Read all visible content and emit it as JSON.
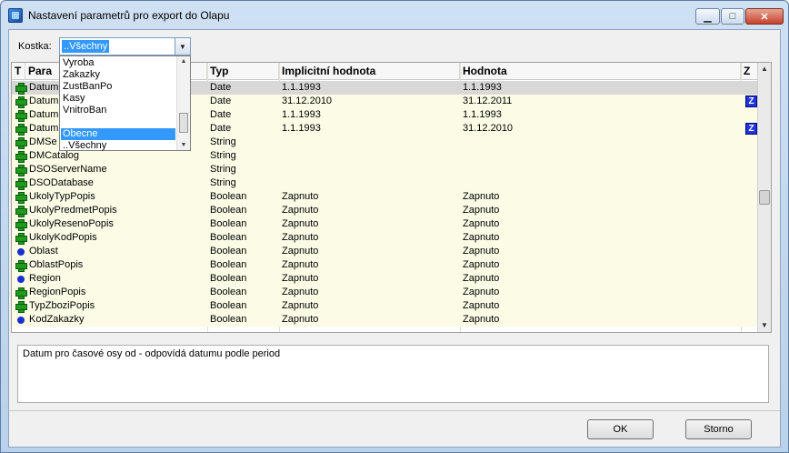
{
  "window": {
    "title": "Nastavení parametrů pro export do Olapu",
    "controls": {
      "minimize": "▁",
      "maximize": "□",
      "close": "✕"
    }
  },
  "kostka": {
    "label": "Kostka:",
    "value": "..Všechny",
    "options": [
      "Vyroba",
      "Zakazky",
      "ZustBanPo",
      "Kasy",
      "VnitroBan",
      "",
      "Obecne",
      "..Všechny"
    ],
    "active_option": "Obecne"
  },
  "grid": {
    "headers": {
      "t": "T",
      "param": "Para",
      "typ": "Typ",
      "implicit": "Implicitní hodnota",
      "hodnota": "Hodnota",
      "z": "Z"
    },
    "rows": [
      {
        "icon": "plus",
        "name": "Datum",
        "typ": "Date",
        "implicit": "1.1.1993",
        "hodnota": "1.1.1993",
        "z": ""
      },
      {
        "icon": "plus",
        "name": "Datum",
        "typ": "Date",
        "implicit": "31.12.2010",
        "hodnota": "31.12.2011",
        "z": "Z"
      },
      {
        "icon": "plus",
        "name": "Datum",
        "typ": "Date",
        "implicit": "1.1.1993",
        "hodnota": "1.1.1993",
        "z": ""
      },
      {
        "icon": "plus",
        "name": "Datum",
        "typ": "Date",
        "implicit": "1.1.1993",
        "hodnota": "31.12.2010",
        "z": "Z"
      },
      {
        "icon": "plus",
        "name": "DMSe",
        "typ": "String",
        "implicit": "",
        "hodnota": "",
        "z": ""
      },
      {
        "icon": "plus",
        "name": "DMCatalog",
        "typ": "String",
        "implicit": "",
        "hodnota": "",
        "z": ""
      },
      {
        "icon": "plus",
        "name": "DSOServerName",
        "typ": "String",
        "implicit": "",
        "hodnota": "",
        "z": ""
      },
      {
        "icon": "plus",
        "name": "DSODatabase",
        "typ": "String",
        "implicit": "",
        "hodnota": "",
        "z": ""
      },
      {
        "icon": "plus",
        "name": "UkolyTypPopis",
        "typ": "Boolean",
        "implicit": "Zapnuto",
        "hodnota": "Zapnuto",
        "z": ""
      },
      {
        "icon": "plus",
        "name": "UkolyPredmetPopis",
        "typ": "Boolean",
        "implicit": "Zapnuto",
        "hodnota": "Zapnuto",
        "z": ""
      },
      {
        "icon": "plus",
        "name": "UkolyResenoPopis",
        "typ": "Boolean",
        "implicit": "Zapnuto",
        "hodnota": "Zapnuto",
        "z": ""
      },
      {
        "icon": "plus",
        "name": "UkolyKodPopis",
        "typ": "Boolean",
        "implicit": "Zapnuto",
        "hodnota": "Zapnuto",
        "z": ""
      },
      {
        "icon": "dot",
        "name": "Oblast",
        "typ": "Boolean",
        "implicit": "Zapnuto",
        "hodnota": "Zapnuto",
        "z": ""
      },
      {
        "icon": "plus",
        "name": "OblastPopis",
        "typ": "Boolean",
        "implicit": "Zapnuto",
        "hodnota": "Zapnuto",
        "z": ""
      },
      {
        "icon": "dot",
        "name": "Region",
        "typ": "Boolean",
        "implicit": "Zapnuto",
        "hodnota": "Zapnuto",
        "z": ""
      },
      {
        "icon": "plus",
        "name": "RegionPopis",
        "typ": "Boolean",
        "implicit": "Zapnuto",
        "hodnota": "Zapnuto",
        "z": ""
      },
      {
        "icon": "plus",
        "name": "TypZboziPopis",
        "typ": "Boolean",
        "implicit": "Zapnuto",
        "hodnota": "Zapnuto",
        "z": ""
      },
      {
        "icon": "dot",
        "name": "KodZakazky",
        "typ": "Boolean",
        "implicit": "Zapnuto",
        "hodnota": "Zapnuto",
        "z": ""
      }
    ]
  },
  "description": "Datum pro časové osy od - odpovídá datumu podle period",
  "buttons": {
    "ok": "OK",
    "cancel": "Storno"
  }
}
